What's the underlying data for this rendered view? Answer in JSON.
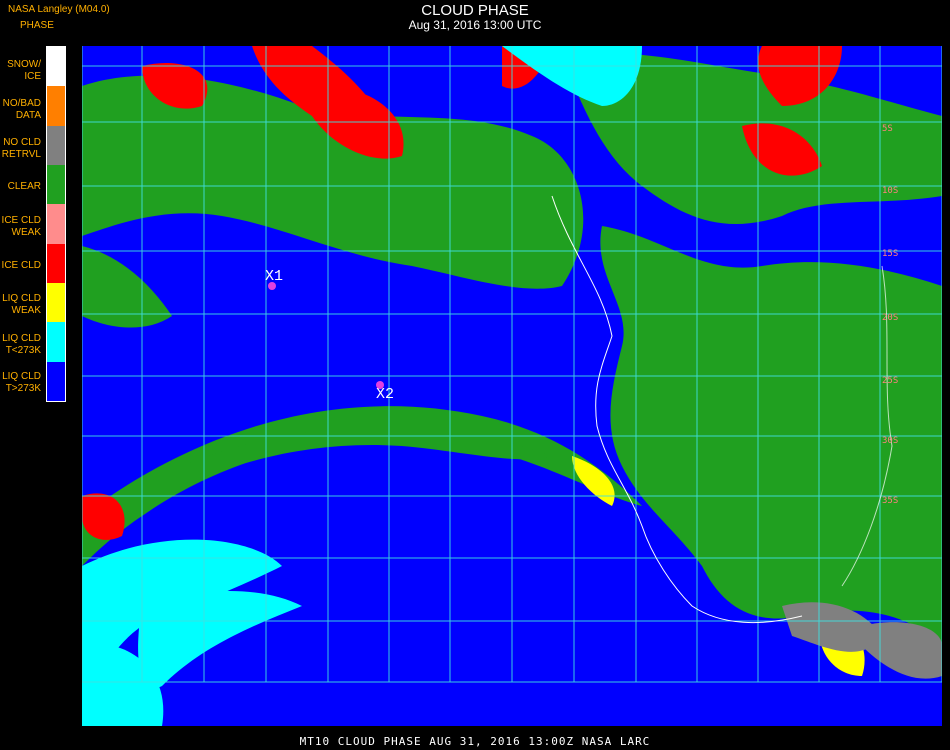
{
  "header": {
    "org": "NASA Langley (M04.0)",
    "legend_title": "PHASE",
    "title": "CLOUD PHASE",
    "subtitle": "Aug 31, 2016 13:00 UTC"
  },
  "legend": [
    {
      "label": "SNOW/\nICE",
      "color": "#ffffff"
    },
    {
      "label": "NO/BAD\nDATA",
      "color": "#ff7f00"
    },
    {
      "label": "NO CLD\nRETRVL",
      "color": "#808080"
    },
    {
      "label": "CLEAR",
      "color": "#20a020"
    },
    {
      "label": "ICE CLD\nWEAK",
      "color": "#ff8c8c"
    },
    {
      "label": "ICE CLD",
      "color": "#ff0000"
    },
    {
      "label": "LIQ CLD\nWEAK",
      "color": "#ffff00"
    },
    {
      "label": "LIQ CLD\nT<273K",
      "color": "#00ffff"
    },
    {
      "label": "LIQ CLD\nT>273K",
      "color": "#0000ff"
    }
  ],
  "markers": [
    {
      "label": "X1"
    },
    {
      "label": "X2"
    }
  ],
  "grid_labels": [
    "5S",
    "10S",
    "15S",
    "20S",
    "25S",
    "30S",
    "35S"
  ],
  "footer": "MT10   CLOUD PHASE    AUG 31, 2016 13:00Z   NASA LARC"
}
